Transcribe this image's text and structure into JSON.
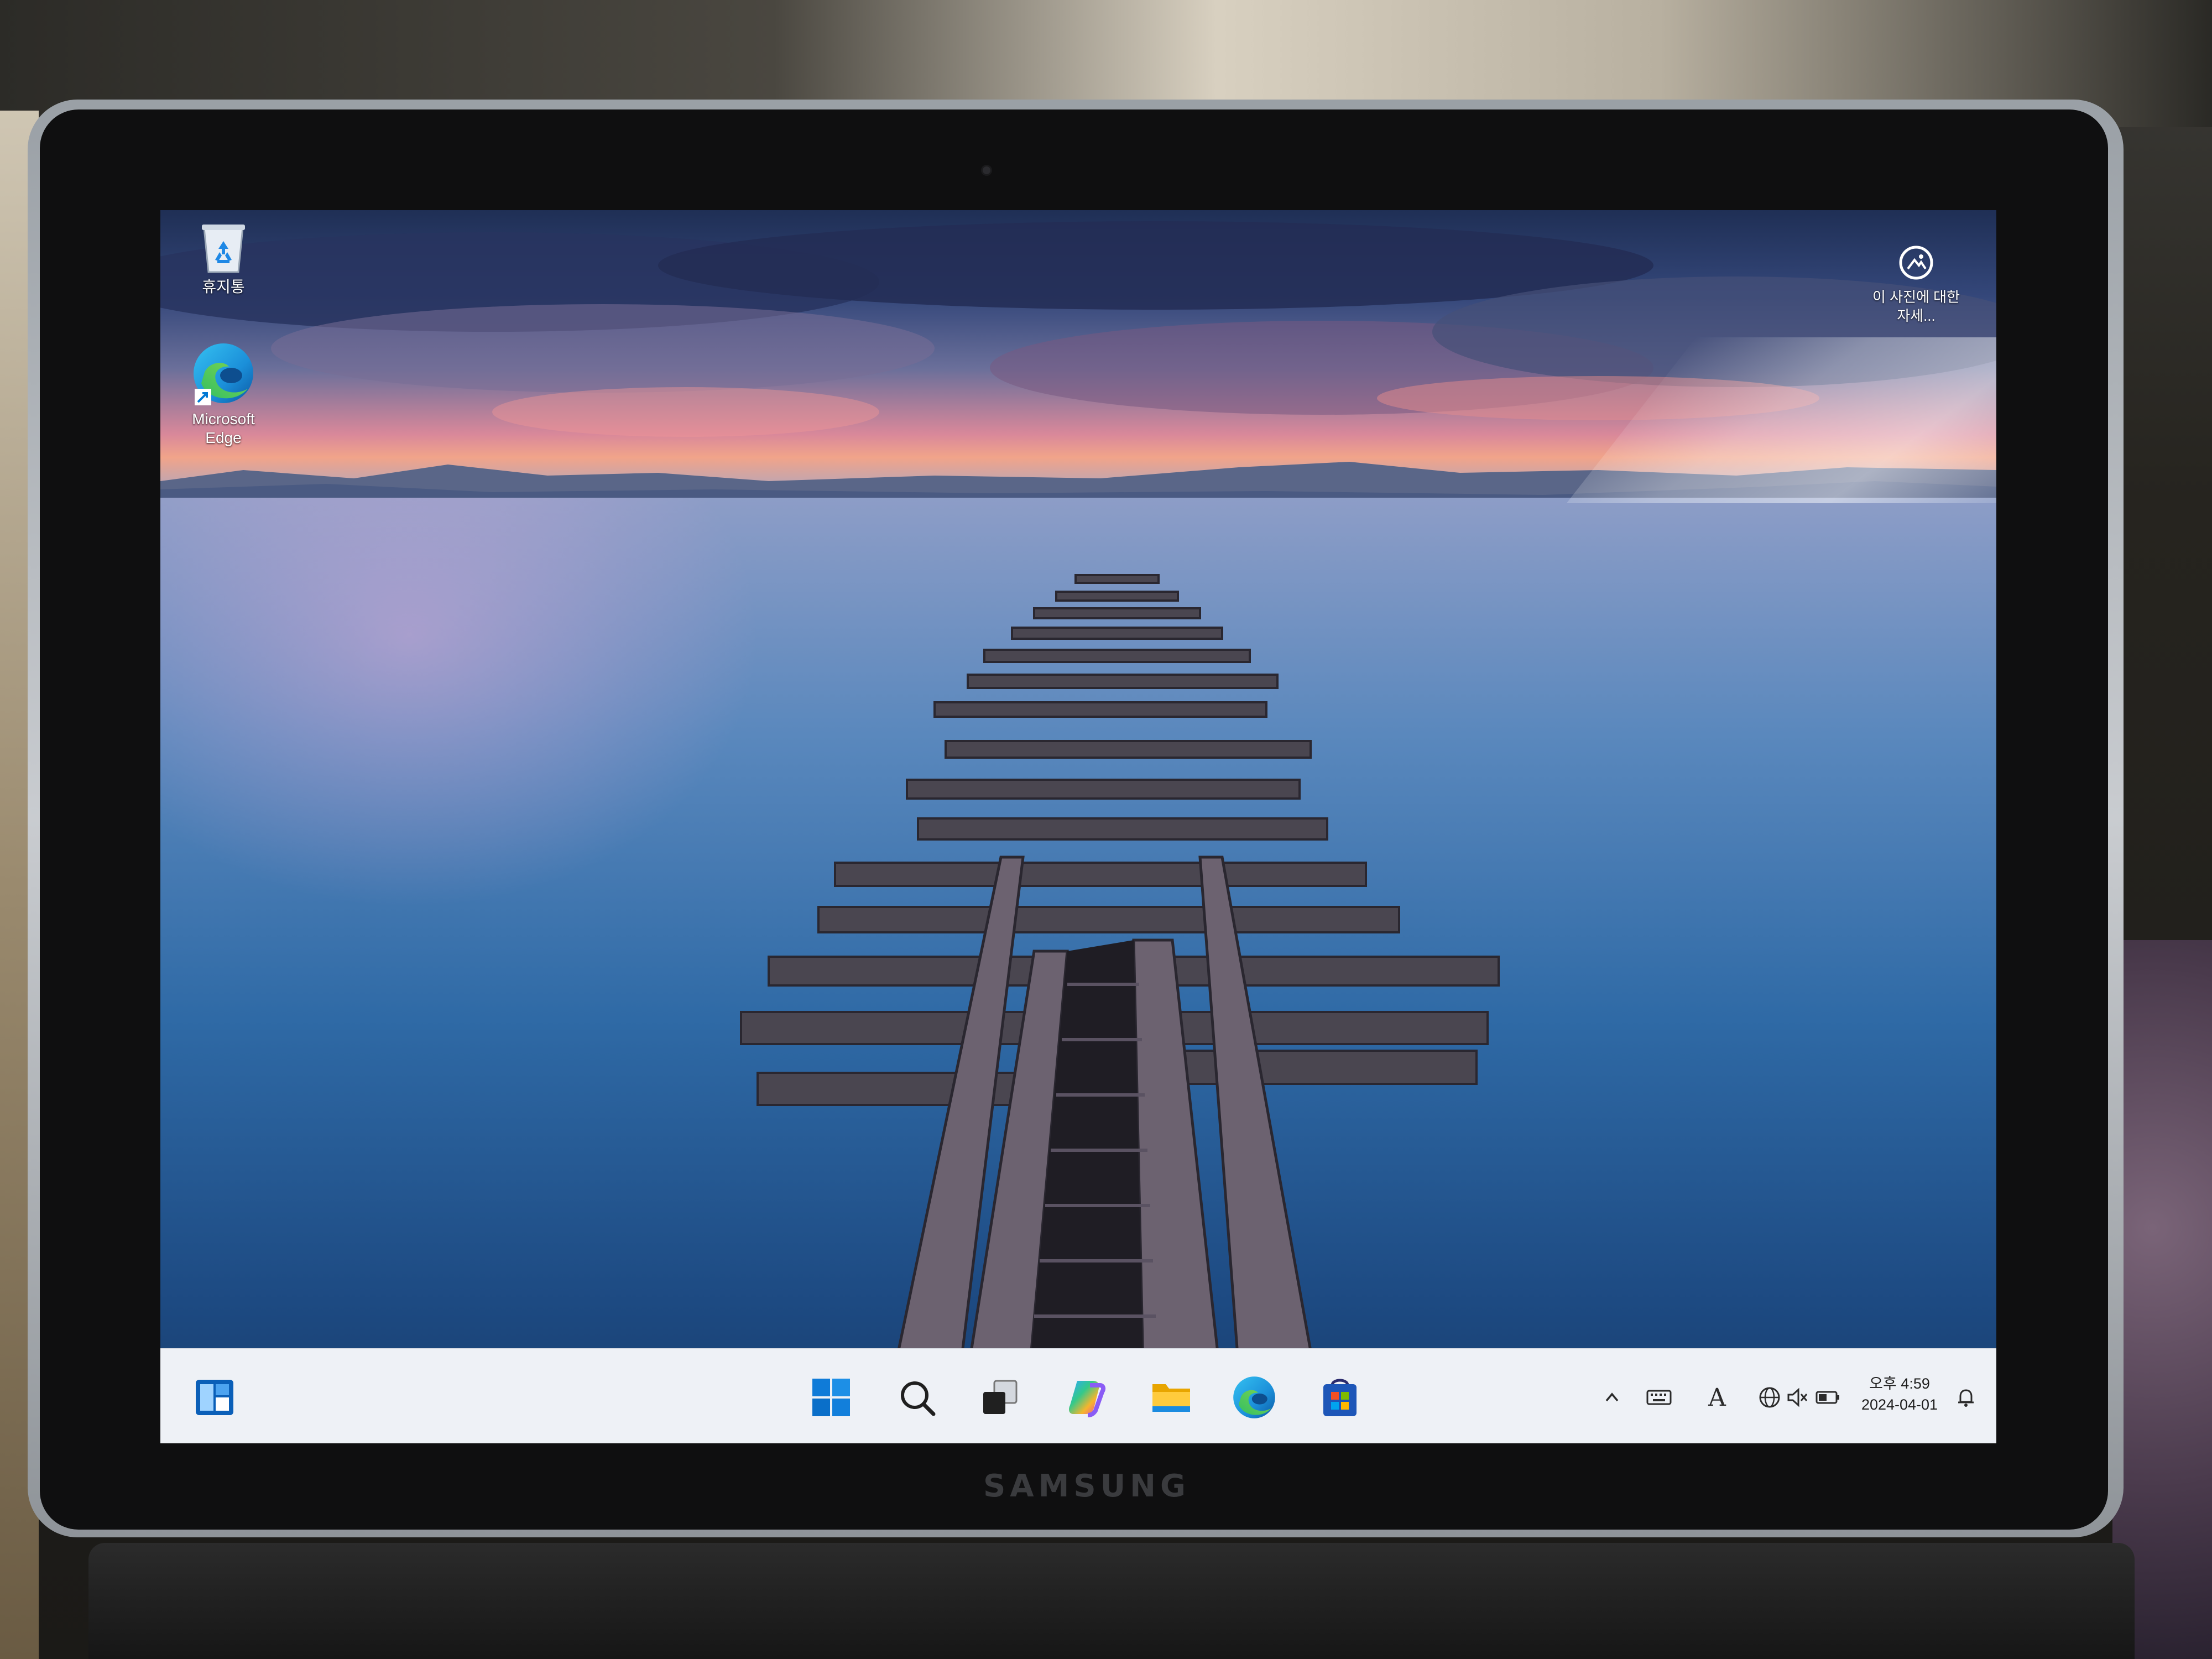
{
  "desktop": {
    "icons": [
      {
        "label": "휴지통",
        "icon": "recycle-bin-icon"
      },
      {
        "label": "Microsoft Edge",
        "icon": "edge-icon"
      }
    ],
    "spotlight": {
      "label": "이 사진에 대한 자세...",
      "icon": "info-icon"
    }
  },
  "taskbar": {
    "widgets_icon": "widgets-icon",
    "apps": [
      {
        "name": "Start",
        "icon": "windows-start-icon"
      },
      {
        "name": "Search",
        "icon": "search-icon"
      },
      {
        "name": "Task View",
        "icon": "task-view-icon"
      },
      {
        "name": "Copilot",
        "icon": "copilot-icon"
      },
      {
        "name": "File Explorer",
        "icon": "folder-icon"
      },
      {
        "name": "Microsoft Edge",
        "icon": "edge-icon"
      },
      {
        "name": "Microsoft Store",
        "icon": "store-icon"
      }
    ],
    "tray": {
      "overflow_icon": "chevron-up-icon",
      "keyboard_icon": "keyboard-icon",
      "ime_label": "A",
      "network_icon": "globe-icon",
      "volume_icon": "volume-muted-icon",
      "battery_icon": "battery-icon",
      "time": "오후 4:59",
      "date": "2024-04-01",
      "notification_icon": "notification-icon"
    }
  },
  "device": {
    "brand": "SAMSUNG"
  },
  "colors": {
    "taskbar_bg": "#eef1f6",
    "accent": "#0078d4"
  }
}
